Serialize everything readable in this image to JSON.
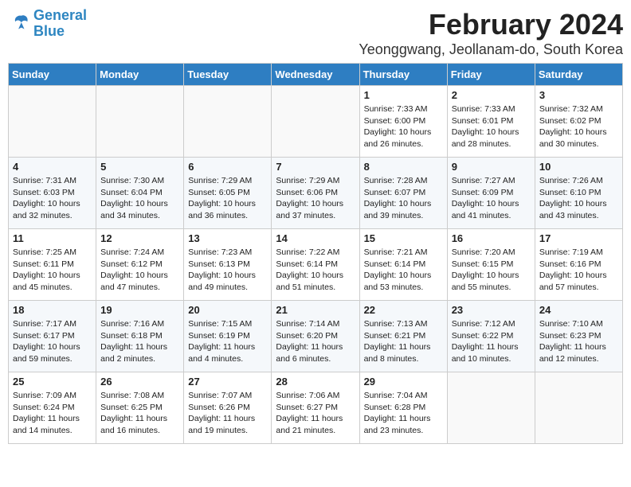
{
  "header": {
    "logo_line1": "General",
    "logo_line2": "Blue",
    "title": "February 2024",
    "subtitle": "Yeonggwang, Jeollanam-do, South Korea"
  },
  "weekdays": [
    "Sunday",
    "Monday",
    "Tuesday",
    "Wednesday",
    "Thursday",
    "Friday",
    "Saturday"
  ],
  "weeks": [
    [
      {
        "day": "",
        "info": ""
      },
      {
        "day": "",
        "info": ""
      },
      {
        "day": "",
        "info": ""
      },
      {
        "day": "",
        "info": ""
      },
      {
        "day": "1",
        "info": "Sunrise: 7:33 AM\nSunset: 6:00 PM\nDaylight: 10 hours\nand 26 minutes."
      },
      {
        "day": "2",
        "info": "Sunrise: 7:33 AM\nSunset: 6:01 PM\nDaylight: 10 hours\nand 28 minutes."
      },
      {
        "day": "3",
        "info": "Sunrise: 7:32 AM\nSunset: 6:02 PM\nDaylight: 10 hours\nand 30 minutes."
      }
    ],
    [
      {
        "day": "4",
        "info": "Sunrise: 7:31 AM\nSunset: 6:03 PM\nDaylight: 10 hours\nand 32 minutes."
      },
      {
        "day": "5",
        "info": "Sunrise: 7:30 AM\nSunset: 6:04 PM\nDaylight: 10 hours\nand 34 minutes."
      },
      {
        "day": "6",
        "info": "Sunrise: 7:29 AM\nSunset: 6:05 PM\nDaylight: 10 hours\nand 36 minutes."
      },
      {
        "day": "7",
        "info": "Sunrise: 7:29 AM\nSunset: 6:06 PM\nDaylight: 10 hours\nand 37 minutes."
      },
      {
        "day": "8",
        "info": "Sunrise: 7:28 AM\nSunset: 6:07 PM\nDaylight: 10 hours\nand 39 minutes."
      },
      {
        "day": "9",
        "info": "Sunrise: 7:27 AM\nSunset: 6:09 PM\nDaylight: 10 hours\nand 41 minutes."
      },
      {
        "day": "10",
        "info": "Sunrise: 7:26 AM\nSunset: 6:10 PM\nDaylight: 10 hours\nand 43 minutes."
      }
    ],
    [
      {
        "day": "11",
        "info": "Sunrise: 7:25 AM\nSunset: 6:11 PM\nDaylight: 10 hours\nand 45 minutes."
      },
      {
        "day": "12",
        "info": "Sunrise: 7:24 AM\nSunset: 6:12 PM\nDaylight: 10 hours\nand 47 minutes."
      },
      {
        "day": "13",
        "info": "Sunrise: 7:23 AM\nSunset: 6:13 PM\nDaylight: 10 hours\nand 49 minutes."
      },
      {
        "day": "14",
        "info": "Sunrise: 7:22 AM\nSunset: 6:14 PM\nDaylight: 10 hours\nand 51 minutes."
      },
      {
        "day": "15",
        "info": "Sunrise: 7:21 AM\nSunset: 6:14 PM\nDaylight: 10 hours\nand 53 minutes."
      },
      {
        "day": "16",
        "info": "Sunrise: 7:20 AM\nSunset: 6:15 PM\nDaylight: 10 hours\nand 55 minutes."
      },
      {
        "day": "17",
        "info": "Sunrise: 7:19 AM\nSunset: 6:16 PM\nDaylight: 10 hours\nand 57 minutes."
      }
    ],
    [
      {
        "day": "18",
        "info": "Sunrise: 7:17 AM\nSunset: 6:17 PM\nDaylight: 10 hours\nand 59 minutes."
      },
      {
        "day": "19",
        "info": "Sunrise: 7:16 AM\nSunset: 6:18 PM\nDaylight: 11 hours\nand 2 minutes."
      },
      {
        "day": "20",
        "info": "Sunrise: 7:15 AM\nSunset: 6:19 PM\nDaylight: 11 hours\nand 4 minutes."
      },
      {
        "day": "21",
        "info": "Sunrise: 7:14 AM\nSunset: 6:20 PM\nDaylight: 11 hours\nand 6 minutes."
      },
      {
        "day": "22",
        "info": "Sunrise: 7:13 AM\nSunset: 6:21 PM\nDaylight: 11 hours\nand 8 minutes."
      },
      {
        "day": "23",
        "info": "Sunrise: 7:12 AM\nSunset: 6:22 PM\nDaylight: 11 hours\nand 10 minutes."
      },
      {
        "day": "24",
        "info": "Sunrise: 7:10 AM\nSunset: 6:23 PM\nDaylight: 11 hours\nand 12 minutes."
      }
    ],
    [
      {
        "day": "25",
        "info": "Sunrise: 7:09 AM\nSunset: 6:24 PM\nDaylight: 11 hours\nand 14 minutes."
      },
      {
        "day": "26",
        "info": "Sunrise: 7:08 AM\nSunset: 6:25 PM\nDaylight: 11 hours\nand 16 minutes."
      },
      {
        "day": "27",
        "info": "Sunrise: 7:07 AM\nSunset: 6:26 PM\nDaylight: 11 hours\nand 19 minutes."
      },
      {
        "day": "28",
        "info": "Sunrise: 7:06 AM\nSunset: 6:27 PM\nDaylight: 11 hours\nand 21 minutes."
      },
      {
        "day": "29",
        "info": "Sunrise: 7:04 AM\nSunset: 6:28 PM\nDaylight: 11 hours\nand 23 minutes."
      },
      {
        "day": "",
        "info": ""
      },
      {
        "day": "",
        "info": ""
      }
    ]
  ]
}
